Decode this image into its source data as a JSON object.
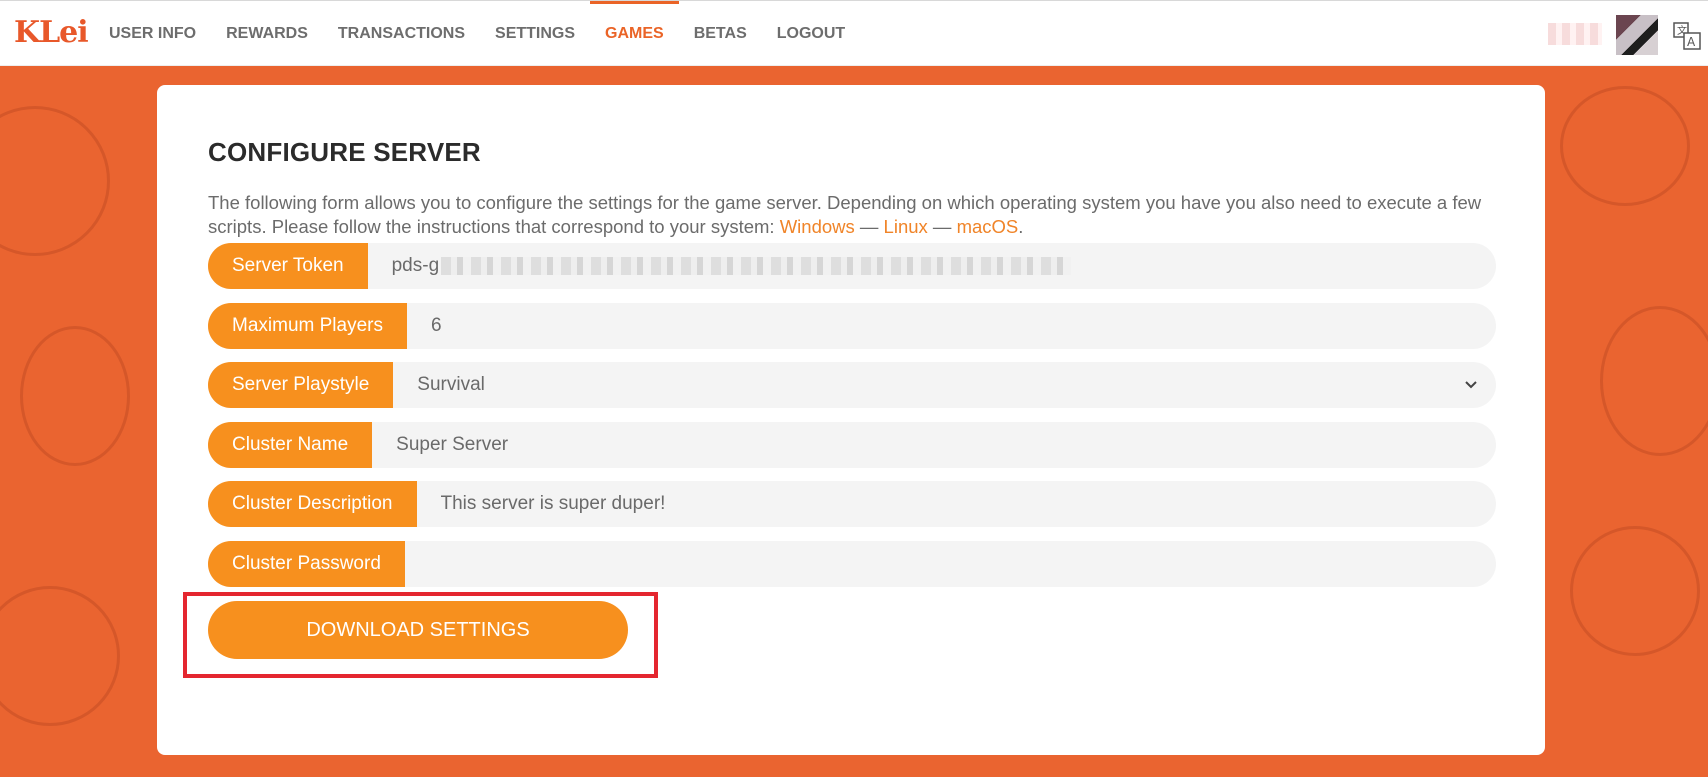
{
  "header": {
    "logo": "KLei",
    "nav": [
      {
        "label": "USER INFO"
      },
      {
        "label": "REWARDS"
      },
      {
        "label": "TRANSACTIONS"
      },
      {
        "label": "SETTINGS"
      },
      {
        "label": "GAMES",
        "active": true
      },
      {
        "label": "BETAS"
      },
      {
        "label": "LOGOUT"
      }
    ],
    "icons": [
      "avatar",
      "translate-icon"
    ]
  },
  "form": {
    "title": "CONFIGURE SERVER",
    "description_text": "The following form allows you to configure the settings for the game server. Depending on which operating system you have you also need to execute a few scripts. Please follow the instructions that correspond to your system: ",
    "links": {
      "windows": "Windows",
      "linux": "Linux",
      "macos": "macOS"
    },
    "separator": " — ",
    "period": ".",
    "fields": {
      "server_token": {
        "label": "Server Token",
        "value_prefix": "pds-g"
      },
      "max_players": {
        "label": "Maximum Players",
        "value": "6"
      },
      "playstyle": {
        "label": "Server Playstyle",
        "value": "Survival"
      },
      "cluster_name": {
        "label": "Cluster Name",
        "value": "Super Server"
      },
      "cluster_description": {
        "label": "Cluster Description",
        "value": "This server is super duper!"
      },
      "cluster_password": {
        "label": "Cluster Password",
        "value": ""
      }
    },
    "download_button": "DOWNLOAD SETTINGS"
  },
  "colors": {
    "accent": "#ea6427",
    "button": "#f7901e",
    "highlight": "#e4262f",
    "background": "#ea6430"
  }
}
